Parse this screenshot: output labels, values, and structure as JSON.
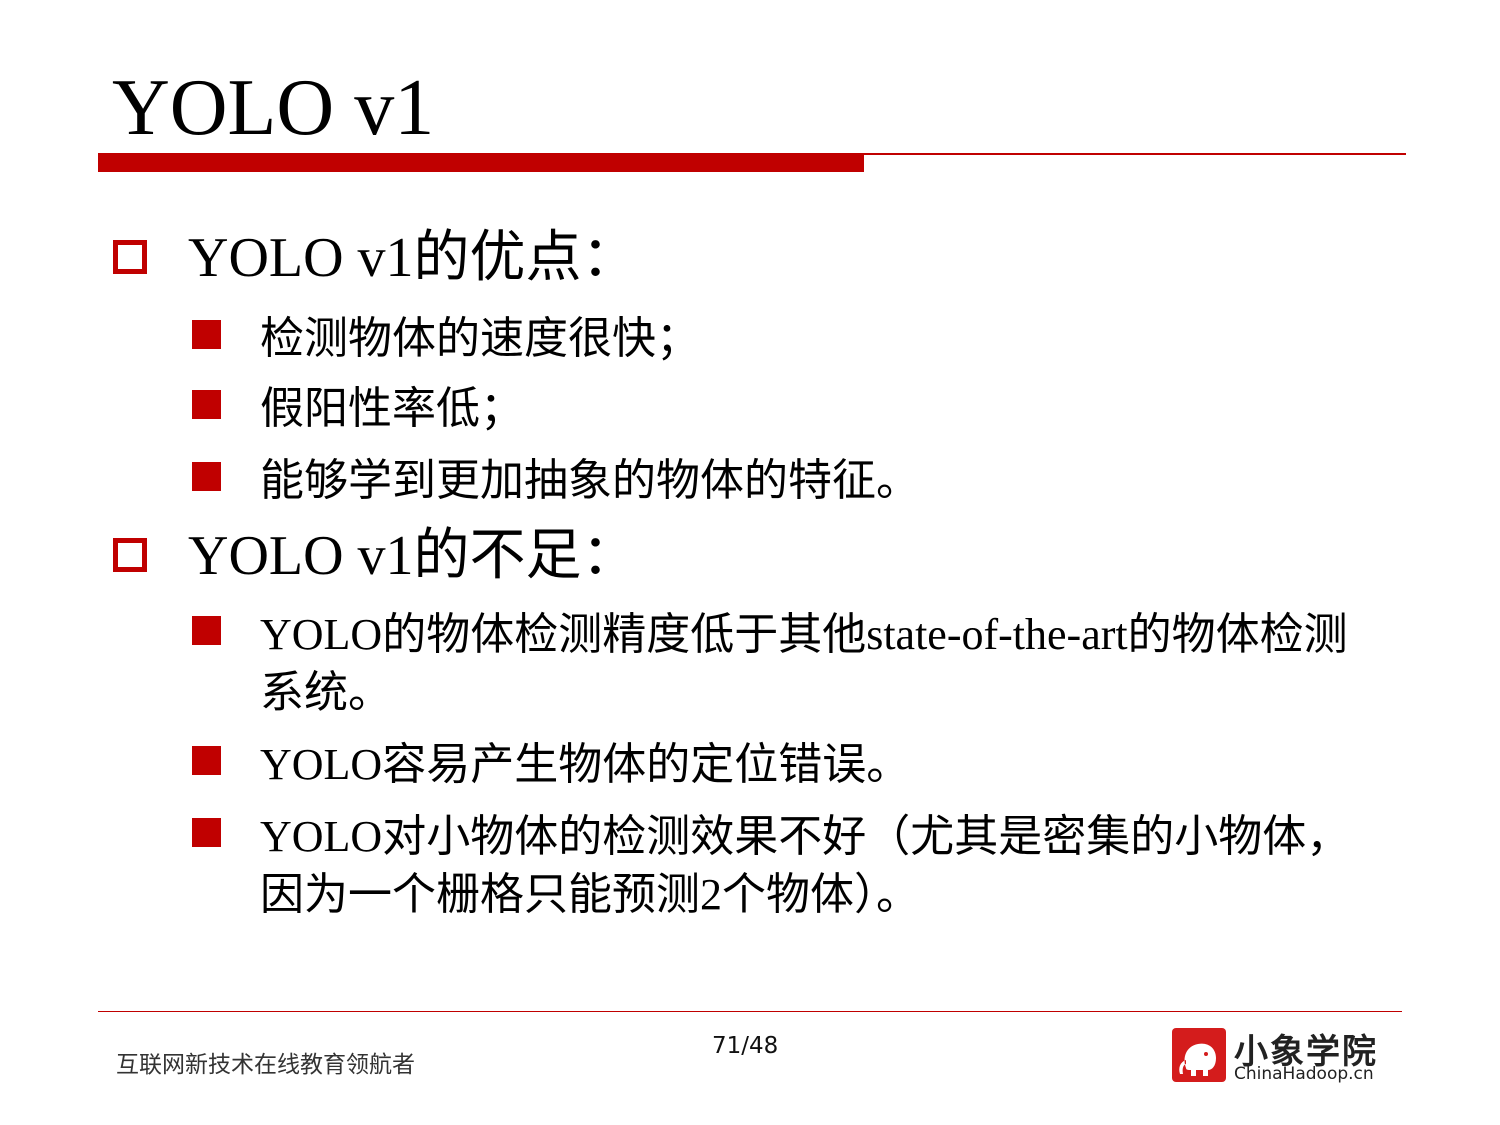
{
  "slide": {
    "title": "YOLO v1",
    "sections": [
      {
        "heading": "YOLO v1的优点：",
        "bullets": [
          "检测物体的速度很快；",
          "假阳性率低；",
          "能够学到更加抽象的物体的特征。"
        ]
      },
      {
        "heading": "YOLO v1的不足：",
        "bullets": [
          "YOLO的物体检测精度低于其他state-of-the-art的物体检测系统。",
          "YOLO容易产生物体的定位错误。",
          "YOLO对小物体的检测效果不好（尤其是密集的小物体，因为一个栅格只能预测2个物体）。"
        ]
      }
    ]
  },
  "footer": {
    "tagline": "互联网新技术在线教育领航者",
    "page_number": "71/48",
    "logo_cn": "小象学院",
    "logo_en": "ChinaHadoop.cn"
  },
  "colors": {
    "accent": "#c00000",
    "logo_red": "#d41c1c"
  },
  "icons": {
    "level1_bullet": "hollow-square-bullet-icon",
    "level2_bullet": "filled-square-bullet-icon",
    "logo": "elephant-logo-icon"
  }
}
